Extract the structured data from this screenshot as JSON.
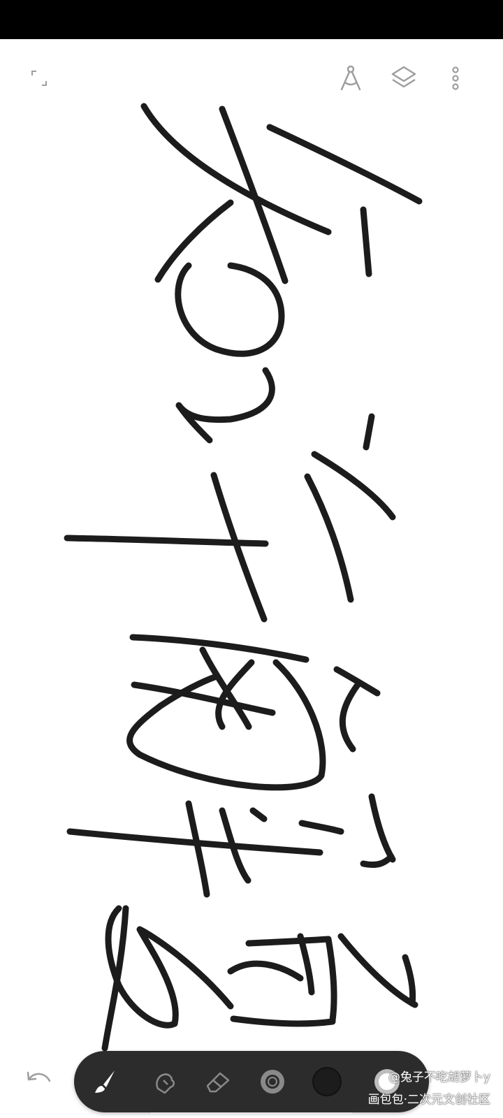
{
  "watermark": {
    "line1": "@兔子不吃胡萝卜y",
    "line2": "画包包·二次元文创社区"
  },
  "colors": {
    "status_bar": "#000000",
    "canvas": "#ffffff",
    "ink": "#1c1c1c",
    "toolbar": "#2c2c2c",
    "toolbar_icon": "#bdbdbd",
    "toolbar_icon_active": "#ffffff",
    "brush_color": "#1c1c1c"
  },
  "icons": {
    "fullscreen": "fullscreen-icon",
    "compass": "ruler-compass-icon",
    "layers": "layers-icon",
    "more": "more-vertical-icon",
    "undo": "undo-icon",
    "brush": "brush-icon",
    "smudge": "smudge-icon",
    "eraser": "eraser-icon",
    "brush_size": "brush-size-icon",
    "color": "color-swatch-icon"
  }
}
